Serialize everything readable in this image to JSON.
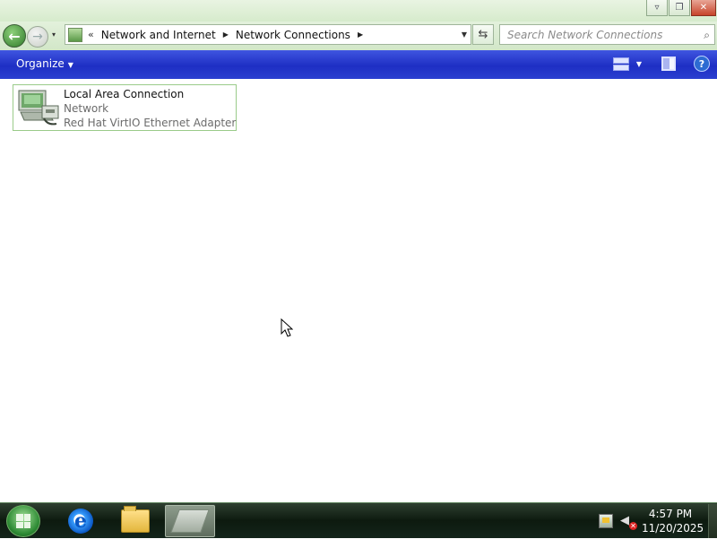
{
  "window": {
    "caption_buttons": {
      "menu": "▿",
      "restore": "❐",
      "close": "✕"
    }
  },
  "navigation": {
    "back_glyph": "←",
    "forward_glyph": "→",
    "recent_glyph": "▾",
    "breadcrumb_overflow": "«",
    "breadcrumbs": [
      "Network and Internet",
      "Network Connections"
    ],
    "crumb_separator": "▶",
    "address_dropdown": "▼",
    "refresh_glyph": "⇆",
    "search_placeholder": "Search Network Connections",
    "search_glyph": "⌕"
  },
  "command_bar": {
    "organize_label": "Organize",
    "organize_caret": "▼",
    "views_caret": "▼",
    "help_glyph": "?"
  },
  "connections": [
    {
      "name": "Local Area Connection",
      "status": "Network",
      "adapter": "Red Hat VirtIO Ethernet Adapter"
    }
  ],
  "taskbar": {
    "ie_glyph": "e",
    "clock_time": "4:57 PM",
    "clock_date": "11/20/2025"
  },
  "icons": {
    "address_bar": "network-and-internet-icon",
    "connection": "network-adapter-icon",
    "tray_network": "network-tray-icon",
    "tray_volume": "volume-muted-icon"
  },
  "colors": {
    "command_bar": "#2233cc",
    "title_chrome": "#d6ebcc",
    "tile_border": "#9acb8a",
    "taskbar": "#13241a"
  }
}
